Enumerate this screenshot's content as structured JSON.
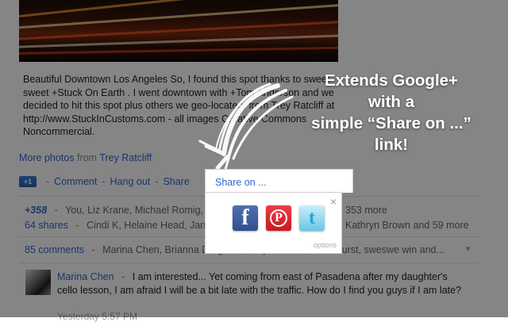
{
  "post": {
    "text": "Beautiful Downtown Los Angeles So, I found this spot thanks to sweet sweet +Stuck On Earth . I went downtown with +Tom Anderson and we decided to hit this spot plus others we geo-located. from Trey Ratcliff at http://www.StuckInCustoms.com - all images Creative Commons Noncommercial.",
    "more_photos": "More photos",
    "from_word": "from",
    "author": "Trey Ratcliff"
  },
  "actions": {
    "plusone": "+1",
    "comment": "Comment",
    "hangout": "Hang out",
    "share": "Share",
    "share_on": "Share on ..."
  },
  "stats": {
    "plus_count": "+358",
    "plus_people": "You, Liz Krane, Michael Romig,",
    "plus_more": "353 more",
    "shares_count": "64 shares",
    "shares_people": "Cindi K, Helaine Head, Jarm",
    "shares_more": "Kathryn Brown and 59 more",
    "comments_count": "85 comments",
    "comments_people": "Marina Chen, Brianna Dargusch, Mirjana Matić, Ken Hurst, sweswe win and..."
  },
  "comment": {
    "author": "Marina Chen",
    "text": "I am interested... Yet coming from east of Pasadena after my daughter's cello lesson, I am afraid I will be a bit late with the traffic. How do I find you guys if I am late?",
    "time": "Yesterday 5:57 PM"
  },
  "popup": {
    "close": "×",
    "options": "options",
    "facebook_glyph": "f",
    "pinterest_glyph": "P",
    "twitter_glyph": "t"
  },
  "callout": {
    "line1": "Extends Google+",
    "line2": "with a",
    "line3": "simple “Share on ...”",
    "line4": "link!"
  },
  "icons": {
    "share_on_popup_close": "close-icon",
    "facebook": "facebook-icon",
    "pinterest": "pinterest-icon",
    "twitter": "twitter-icon",
    "expand": "chevron-down-icon"
  },
  "colors": {
    "link": "#3366cc",
    "overlay": "rgba(0,0,0,0.48)",
    "facebook": "#3b5998",
    "pinterest": "#cb2027",
    "twitter": "#55c3e8"
  }
}
